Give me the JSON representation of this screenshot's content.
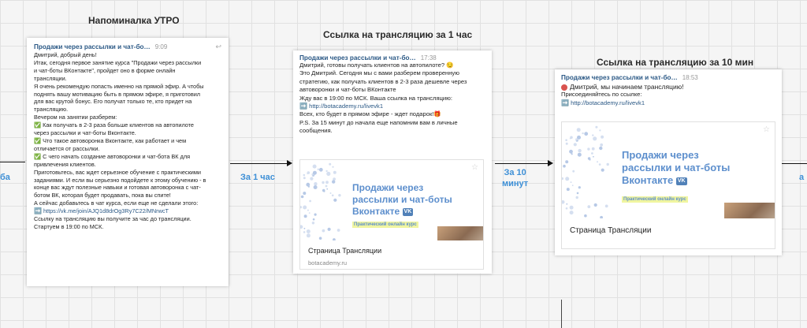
{
  "column1": {
    "title": "Напоминалка УТРО",
    "message": {
      "sender": "Продажи через рассылки и чат-бо…",
      "time": "9:09",
      "lines": [
        "Дмитрий, добрый день!",
        "",
        "Итак, сегодня первое занятие курса \"Продажи через рассылки",
        "и чат-боты ВКонтакте\", пройдет оно в форме онлайн",
        "трансляции.",
        "",
        "Я очень рекомендую попасть именно на прямой эфир. А чтобы",
        "поднять вашу мотивацию быть в прямом эфире, я приготовил",
        "для вас крутой бонус. Его получат только те, кто придет на",
        "трансляцию.",
        "",
        "Вечером на занятии разберем:",
        "✅ Как получать в 2-3 раза больше клиентов на автопилоте",
        "через рассылки и чат-боты Вконтакте.",
        "✅ Что такое автоворонка Вконтакте, как работает и чем",
        "отличается от рассылки.",
        "✅ С чего начать создание автоворонки и чат-бота ВК для",
        "привлечения клиентов.",
        "",
        "Приготовьтесь, вас ждет серьезное обучение с практическими",
        "заданиями. И если вы серьезно подойдете к этому обучению - в",
        "конце вас ждут полезные навыки и готовая автоворонка с чат-",
        "ботом ВК, которая будет продавать, пока вы спите!",
        "",
        "А сейчас добавьтесь в чат курса, если еще не сделали этого:"
      ],
      "link": "https://vk.me/join/AJQ1d8drOg3Ry7C22/MNrwcT",
      "tail_lines": [
        "",
        "Ссылку на трансляцию вы получите за час до трансляции.",
        "Стартуем в 19:00 по МСК."
      ]
    }
  },
  "column2": {
    "title": "Ссылка на трансляцию за 1 час",
    "message": {
      "sender": "Продажи через рассылки и чат-бо…",
      "time": "17:38",
      "lines": [
        "Дмитрий, готовы получать клиентов на автопилоте? 😏",
        "",
        "Это Дмитрий. Сегодня мы с вами разберем проверенную",
        "стратегию, как получать клиентов в 2-3 раза дешевле через",
        "автоворонки и чат-боты ВКонтакте",
        "",
        "Жду вас в 19:00 по МСК. Ваша ссылка на трансляцию:"
      ],
      "link": "http://botacademy.ru/livevk1",
      "tail_lines": [
        "",
        "Всех, кто будет в прямом эфире - ждет подарок!🎁",
        "P.S. За 15 минут до начала еще напомним вам в личные",
        "сообщения."
      ],
      "preview": {
        "title_lines": [
          "Продажи через",
          "рассылки и чат-боты",
          "Вконтакте"
        ],
        "badge": "VK",
        "subtitle": "Практический онлайн курс",
        "caption": "Страница Трансляции",
        "domain": "botacademy.ru"
      }
    }
  },
  "column3": {
    "title": "Ссылка на трансляцию за 10 мин",
    "message": {
      "sender": "Продажи через рассылки и чат-бо…",
      "time": "18:53",
      "greeting": "Дмитрий, мы начинаем трансляцию!",
      "lines": [
        "",
        "Присоединяйтесь по ссылке:"
      ],
      "link": "http://botacademy.ru/livevk1",
      "preview": {
        "title_lines": [
          "Продажи через",
          "рассылки и чат-боты",
          "Вконтакте"
        ],
        "badge": "VK",
        "subtitle": "Практический онлайн курс",
        "caption": "Страница Трансляции"
      }
    }
  },
  "connectors": {
    "label_1": "За 1 час",
    "label_2a": "За 10",
    "label_2b": "минут",
    "edge_left": "ба",
    "edge_right": "а"
  },
  "icons": {
    "check": "✅",
    "arrow_link": "➡️",
    "reply": "↩",
    "star": "☆"
  }
}
